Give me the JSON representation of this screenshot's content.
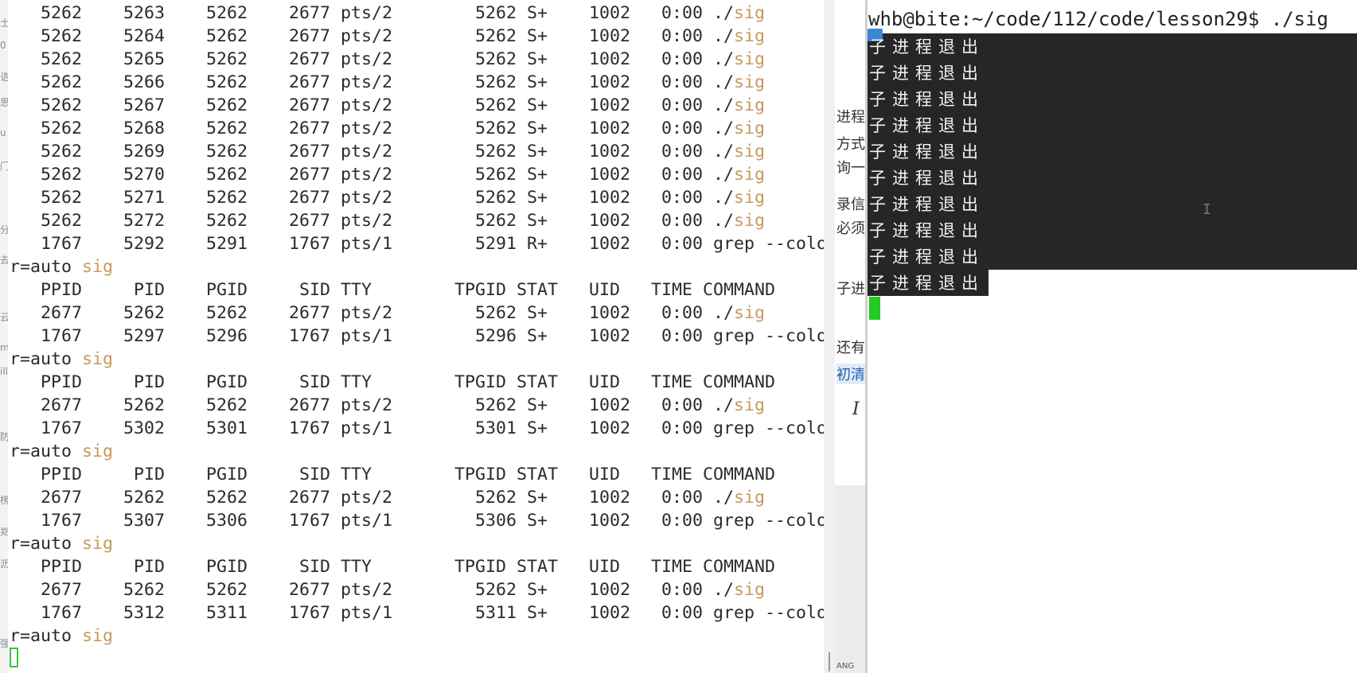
{
  "left_terminal": {
    "lines": [
      {
        "pre": "   5262    5263    5262    2677 pts/2        5262 S+    1002   0:00 ./",
        "hl": "sig",
        "post": ""
      },
      {
        "pre": "   5262    5264    5262    2677 pts/2        5262 S+    1002   0:00 ./",
        "hl": "sig",
        "post": ""
      },
      {
        "pre": "   5262    5265    5262    2677 pts/2        5262 S+    1002   0:00 ./",
        "hl": "sig",
        "post": ""
      },
      {
        "pre": "   5262    5266    5262    2677 pts/2        5262 S+    1002   0:00 ./",
        "hl": "sig",
        "post": ""
      },
      {
        "pre": "   5262    5267    5262    2677 pts/2        5262 S+    1002   0:00 ./",
        "hl": "sig",
        "post": ""
      },
      {
        "pre": "   5262    5268    5262    2677 pts/2        5262 S+    1002   0:00 ./",
        "hl": "sig",
        "post": ""
      },
      {
        "pre": "   5262    5269    5262    2677 pts/2        5262 S+    1002   0:00 ./",
        "hl": "sig",
        "post": ""
      },
      {
        "pre": "   5262    5270    5262    2677 pts/2        5262 S+    1002   0:00 ./",
        "hl": "sig",
        "post": ""
      },
      {
        "pre": "   5262    5271    5262    2677 pts/2        5262 S+    1002   0:00 ./",
        "hl": "sig",
        "post": ""
      },
      {
        "pre": "   5262    5272    5262    2677 pts/2        5262 S+    1002   0:00 ./",
        "hl": "sig",
        "post": ""
      },
      {
        "pre": "   1767    5292    5291    1767 pts/1        5291 R+    1002   0:00 grep --colo",
        "hl": "",
        "post": ""
      },
      {
        "pre": "r=auto ",
        "hl": "sig",
        "post": ""
      },
      {
        "pre": "   PPID     PID    PGID     SID TTY        TPGID STAT   UID   TIME COMMAND",
        "hl": "",
        "post": ""
      },
      {
        "pre": "   2677    5262    5262    2677 pts/2        5262 S+    1002   0:00 ./",
        "hl": "sig",
        "post": ""
      },
      {
        "pre": "   1767    5297    5296    1767 pts/1        5296 S+    1002   0:00 grep --colo",
        "hl": "",
        "post": ""
      },
      {
        "pre": "r=auto ",
        "hl": "sig",
        "post": ""
      },
      {
        "pre": "   PPID     PID    PGID     SID TTY        TPGID STAT   UID   TIME COMMAND",
        "hl": "",
        "post": ""
      },
      {
        "pre": "   2677    5262    5262    2677 pts/2        5262 S+    1002   0:00 ./",
        "hl": "sig",
        "post": ""
      },
      {
        "pre": "   1767    5302    5301    1767 pts/1        5301 S+    1002   0:00 grep --colo",
        "hl": "",
        "post": ""
      },
      {
        "pre": "r=auto ",
        "hl": "sig",
        "post": ""
      },
      {
        "pre": "   PPID     PID    PGID     SID TTY        TPGID STAT   UID   TIME COMMAND",
        "hl": "",
        "post": ""
      },
      {
        "pre": "   2677    5262    5262    2677 pts/2        5262 S+    1002   0:00 ./",
        "hl": "sig",
        "post": ""
      },
      {
        "pre": "   1767    5307    5306    1767 pts/1        5306 S+    1002   0:00 grep --colo",
        "hl": "",
        "post": ""
      },
      {
        "pre": "r=auto ",
        "hl": "sig",
        "post": ""
      },
      {
        "pre": "   PPID     PID    PGID     SID TTY        TPGID STAT   UID   TIME COMMAND",
        "hl": "",
        "post": ""
      },
      {
        "pre": "   2677    5262    5262    2677 pts/2        5262 S+    1002   0:00 ./",
        "hl": "sig",
        "post": ""
      },
      {
        "pre": "   1767    5312    5311    1767 pts/1        5311 S+    1002   0:00 grep --colo",
        "hl": "",
        "post": ""
      },
      {
        "pre": "r=auto ",
        "hl": "sig",
        "post": ""
      }
    ]
  },
  "middle_panel": {
    "fragments": [
      "进程",
      "方式,",
      "询一",
      "录信号",
      "必须",
      "子进",
      "还有",
      "初清",
      "ANG"
    ],
    "italic_icon": "I"
  },
  "right_terminal": {
    "prompt": "whb@bite:~/code/112/code/lesson29$ ./sig",
    "output_line": "子进程退出",
    "output_count": 10
  },
  "colors": {
    "highlight": "#c5995c",
    "cursor_green": "#22cc22",
    "terminal_dark": "#262626"
  }
}
